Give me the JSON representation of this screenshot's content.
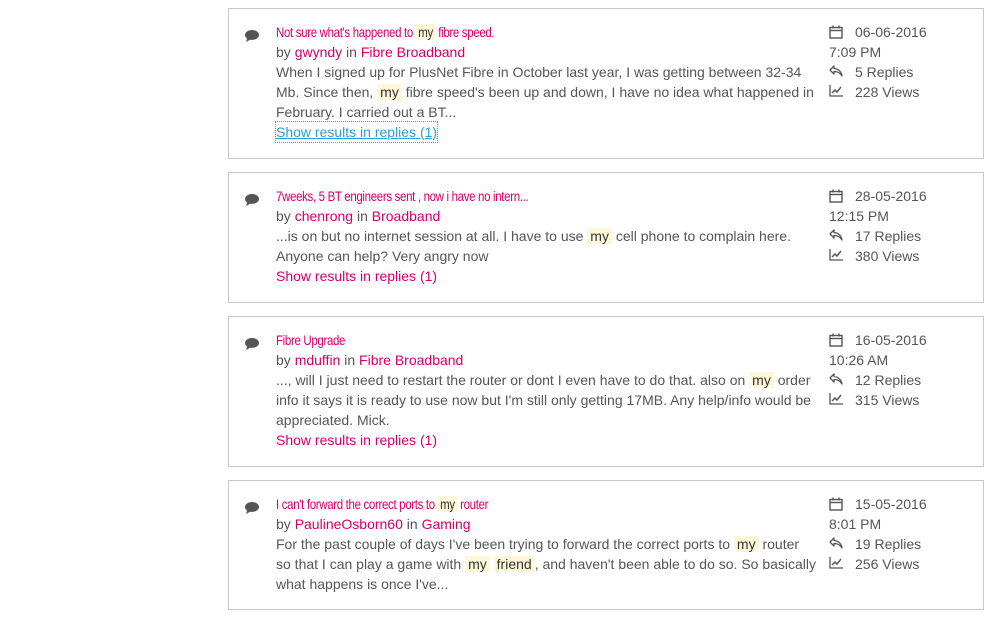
{
  "results": [
    {
      "title_parts": [
        "Not sure what's happened to ",
        "my",
        " fibre speed."
      ],
      "author": "gwyndy",
      "in_label": "in",
      "by_label": "by",
      "board": "Fibre Broadband",
      "snippet_parts": [
        "When I signed up for PlusNet Fibre in October last year, I was getting between 32-34 Mb. Since then, ",
        "my",
        " fibre speed's been up and down, I have no idea what happened in February. I carried out a BT..."
      ],
      "replies_link": "Show results in replies (1)",
      "date": "06-06-2016",
      "time": "7:09 PM",
      "replies": "5 Replies",
      "views": "228 Views"
    },
    {
      "title_parts": [
        "7weeks, 5 BT engineers sent , now i have no intern..."
      ],
      "author": "chenrong",
      "in_label": "in",
      "by_label": "by",
      "board": "Broadband",
      "snippet_parts": [
        "...is on but no internet session at all. I have to use ",
        "my",
        " cell phone to complain here. Anyone can help? Very angry now"
      ],
      "replies_link": "Show results in replies (1)",
      "date": "28-05-2016",
      "time": "12:15 PM",
      "replies": "17 Replies",
      "views": "380 Views"
    },
    {
      "title_parts": [
        "Fibre Upgrade"
      ],
      "author": "mduffin",
      "in_label": "in",
      "by_label": "by",
      "board": "Fibre Broadband",
      "snippet_parts": [
        "..., will I just need to restart the router or dont I even have to do that. also on ",
        "my",
        " order info it says it is ready to use now but I'm still only getting 17MB. Any help/info would be appreciated. Mick."
      ],
      "replies_link": "Show results in replies (1)",
      "date": "16-05-2016",
      "time": "10:26 AM",
      "replies": "12 Replies",
      "views": "315 Views"
    },
    {
      "title_parts": [
        "I can't forward the correct ports to ",
        "my",
        " router"
      ],
      "author": "PaulineOsborn60",
      "in_label": "in",
      "by_label": "by",
      "board": "Gaming",
      "snippet_parts": [
        "For the past couple of days I've been trying to forward the correct ports to ",
        "my",
        " router so that I can play a game with ",
        "my",
        " ",
        "friend",
        ", and haven't been able to do so. So basically what happens is once I've..."
      ],
      "date": "15-05-2016",
      "time": "8:01 PM",
      "replies": "19 Replies",
      "views": "256 Views"
    }
  ],
  "colors": {
    "accent": "#d2006b",
    "highlight": "#fff8d8",
    "focus_link": "#2a9fd6"
  },
  "icons": {
    "message": "speech-bubble-icon",
    "date": "calendar-icon",
    "replies": "reply-arrow-icon",
    "views": "chart-icon"
  }
}
